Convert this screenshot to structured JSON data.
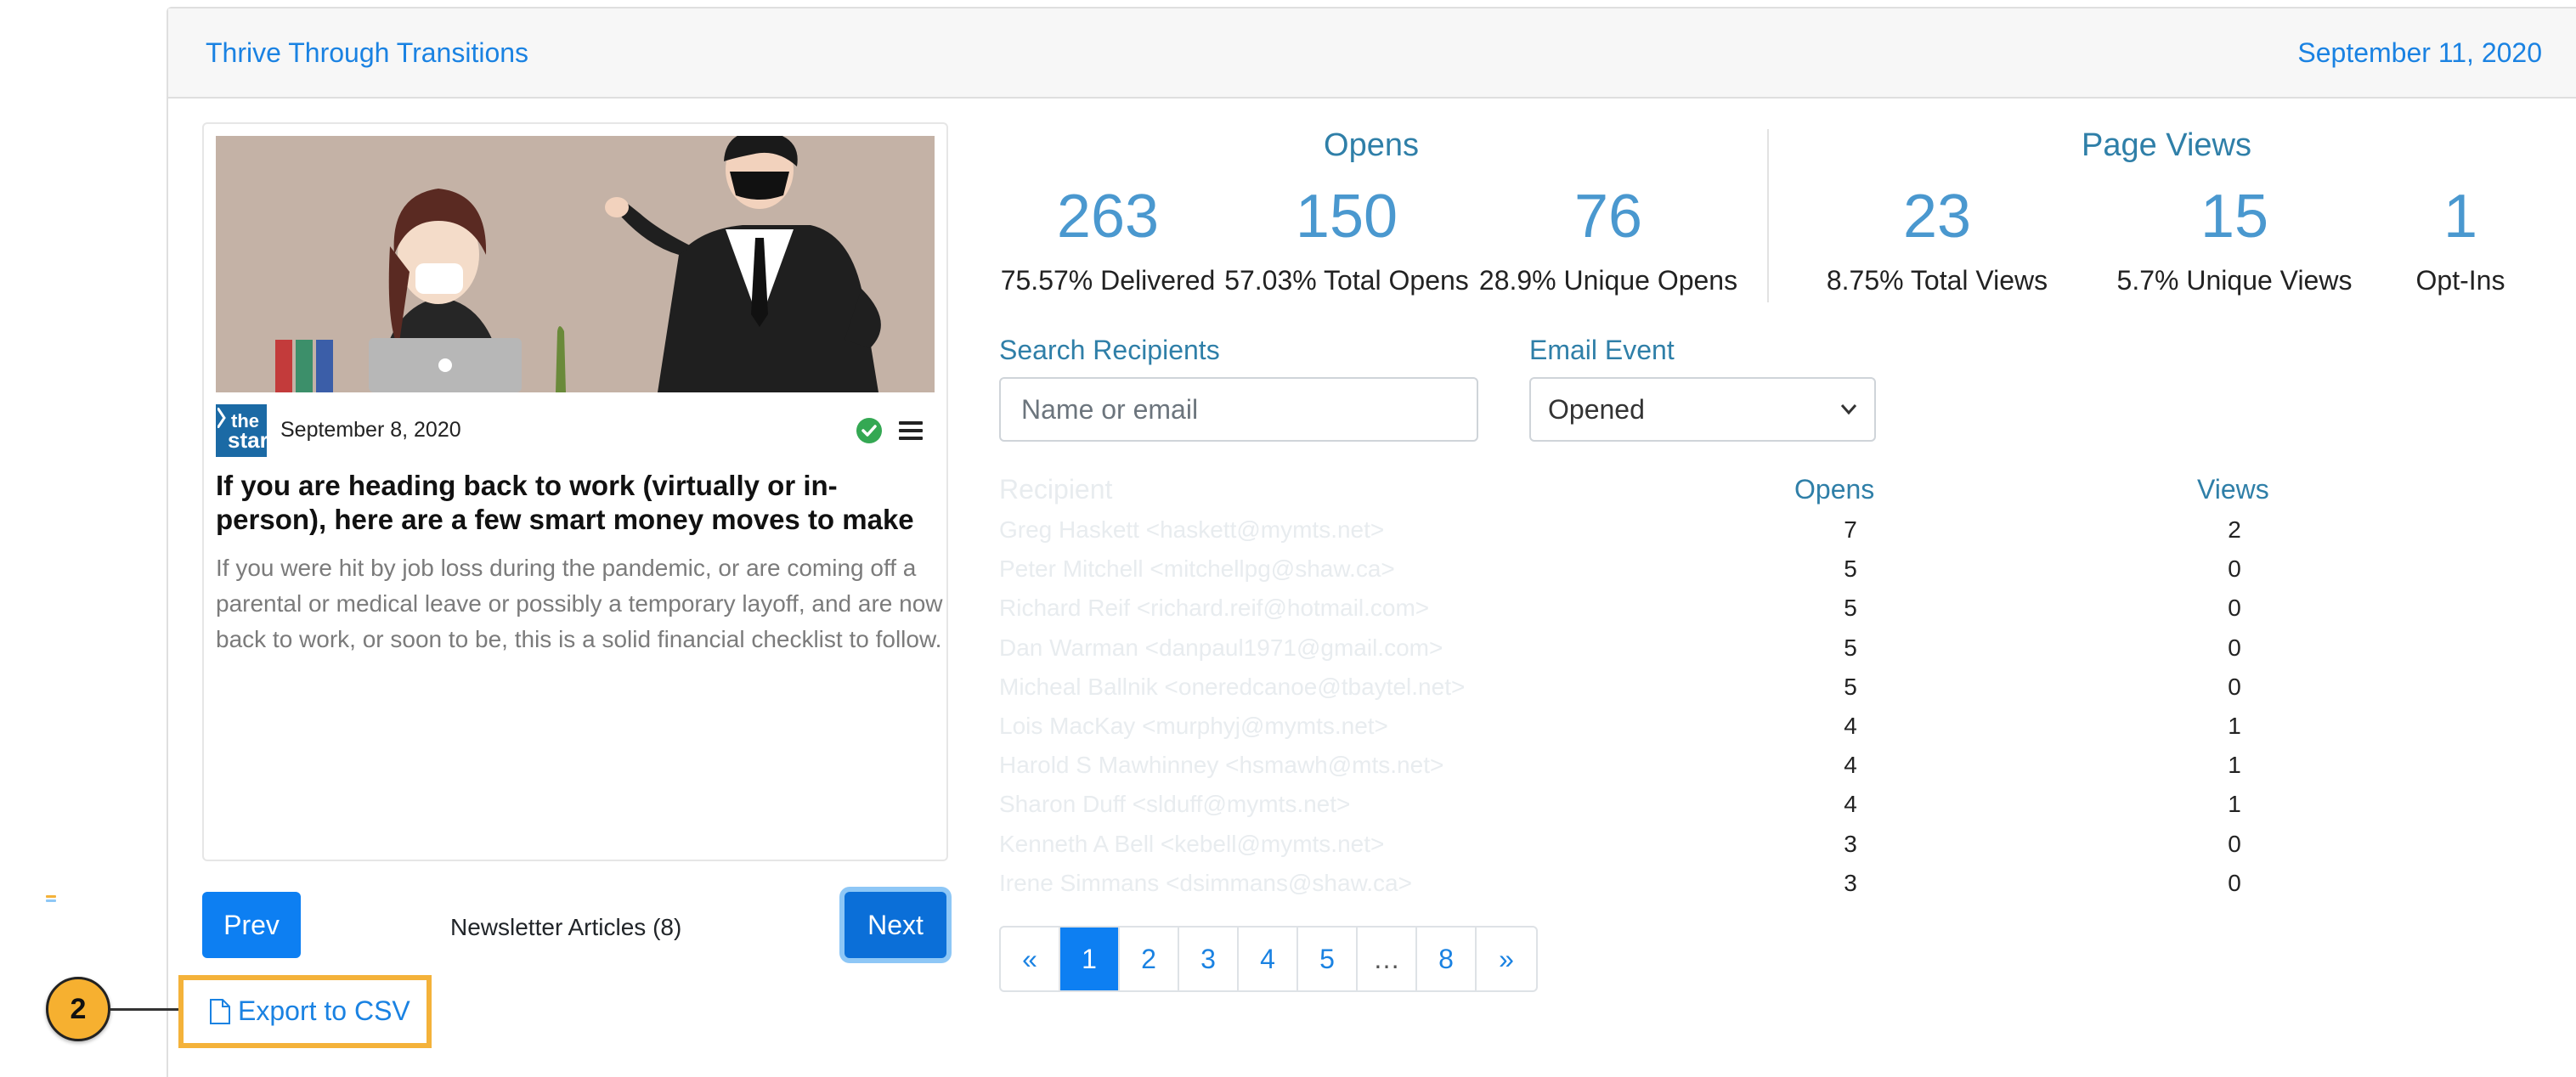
{
  "header": {
    "title": "Thrive Through Transitions",
    "date": "September 11, 2020"
  },
  "article": {
    "source_logo": {
      "line1": "the",
      "line2": "star"
    },
    "date": "September 8, 2020",
    "title": "If you are heading back to work (virtually or in-person), here are a few smart money moves to make",
    "summary": "If you were hit by job loss during the pandemic, or are coming off a parental or medical leave or possibly a temporary layoff, and are now back to work, or soon to be, this is a solid financial checklist to follow.",
    "status_icon": "check-circle-icon",
    "menu_icon": "hamburger-menu-icon"
  },
  "nav": {
    "prev_label": "Prev",
    "next_label": "Next",
    "count_label": "Newsletter Articles (8)"
  },
  "export": {
    "label": "Export to CSV",
    "step_number": "2"
  },
  "stats": {
    "opens": {
      "heading": "Opens",
      "items": [
        {
          "value": "263",
          "label": "75.57% Delivered"
        },
        {
          "value": "150",
          "label": "57.03% Total Opens"
        },
        {
          "value": "76",
          "label": "28.9% Unique Opens"
        }
      ]
    },
    "page_views": {
      "heading": "Page Views",
      "items": [
        {
          "value": "23",
          "label": "8.75% Total Views"
        },
        {
          "value": "15",
          "label": "5.7% Unique Views"
        },
        {
          "value": "1",
          "label": "Opt-Ins"
        }
      ]
    }
  },
  "filters": {
    "search_label": "Search Recipients",
    "search_placeholder": "Name or email",
    "event_label": "Email Event",
    "event_selected": "Opened"
  },
  "recipients": {
    "columns": {
      "recipient": "Recipient",
      "opens": "Opens",
      "views": "Views"
    },
    "rows": [
      {
        "name": "Greg Haskett <haskett@mymts.net>",
        "opens": "7",
        "views": "2"
      },
      {
        "name": "Peter Mitchell <mitchellpg@shaw.ca>",
        "opens": "5",
        "views": "0"
      },
      {
        "name": "Richard Reif <richard.reif@hotmail.com>",
        "opens": "5",
        "views": "0"
      },
      {
        "name": "Dan Warman <danpaul1971@gmail.com>",
        "opens": "5",
        "views": "0"
      },
      {
        "name": "Micheal Ballnik <oneredcanoe@tbaytel.net>",
        "opens": "5",
        "views": "0"
      },
      {
        "name": "Lois MacKay <murphyj@mymts.net>",
        "opens": "4",
        "views": "1"
      },
      {
        "name": "Harold S Mawhinney <hsmawh@mts.net>",
        "opens": "4",
        "views": "1"
      },
      {
        "name": "Sharon Duff <slduff@mymts.net>",
        "opens": "4",
        "views": "1"
      },
      {
        "name": "Kenneth A Bell <kebell@mymts.net>",
        "opens": "3",
        "views": "0"
      },
      {
        "name": "Irene Simmans <dsimmans@shaw.ca>",
        "opens": "3",
        "views": "0"
      }
    ]
  },
  "pagination": {
    "pages": [
      {
        "label": "«",
        "active": false
      },
      {
        "label": "1",
        "active": true
      },
      {
        "label": "2",
        "active": false
      },
      {
        "label": "3",
        "active": false
      },
      {
        "label": "4",
        "active": false
      },
      {
        "label": "5",
        "active": false
      },
      {
        "label": "…",
        "active": false
      },
      {
        "label": "8",
        "active": false
      },
      {
        "label": "»",
        "active": false
      }
    ]
  },
  "colors": {
    "accent": "#0d7ff2",
    "link": "#1a82e2",
    "stat_number": "#4a98cf",
    "stat_heading": "#2f7fa8",
    "highlight": "#f4b23a",
    "success": "#34a853"
  }
}
